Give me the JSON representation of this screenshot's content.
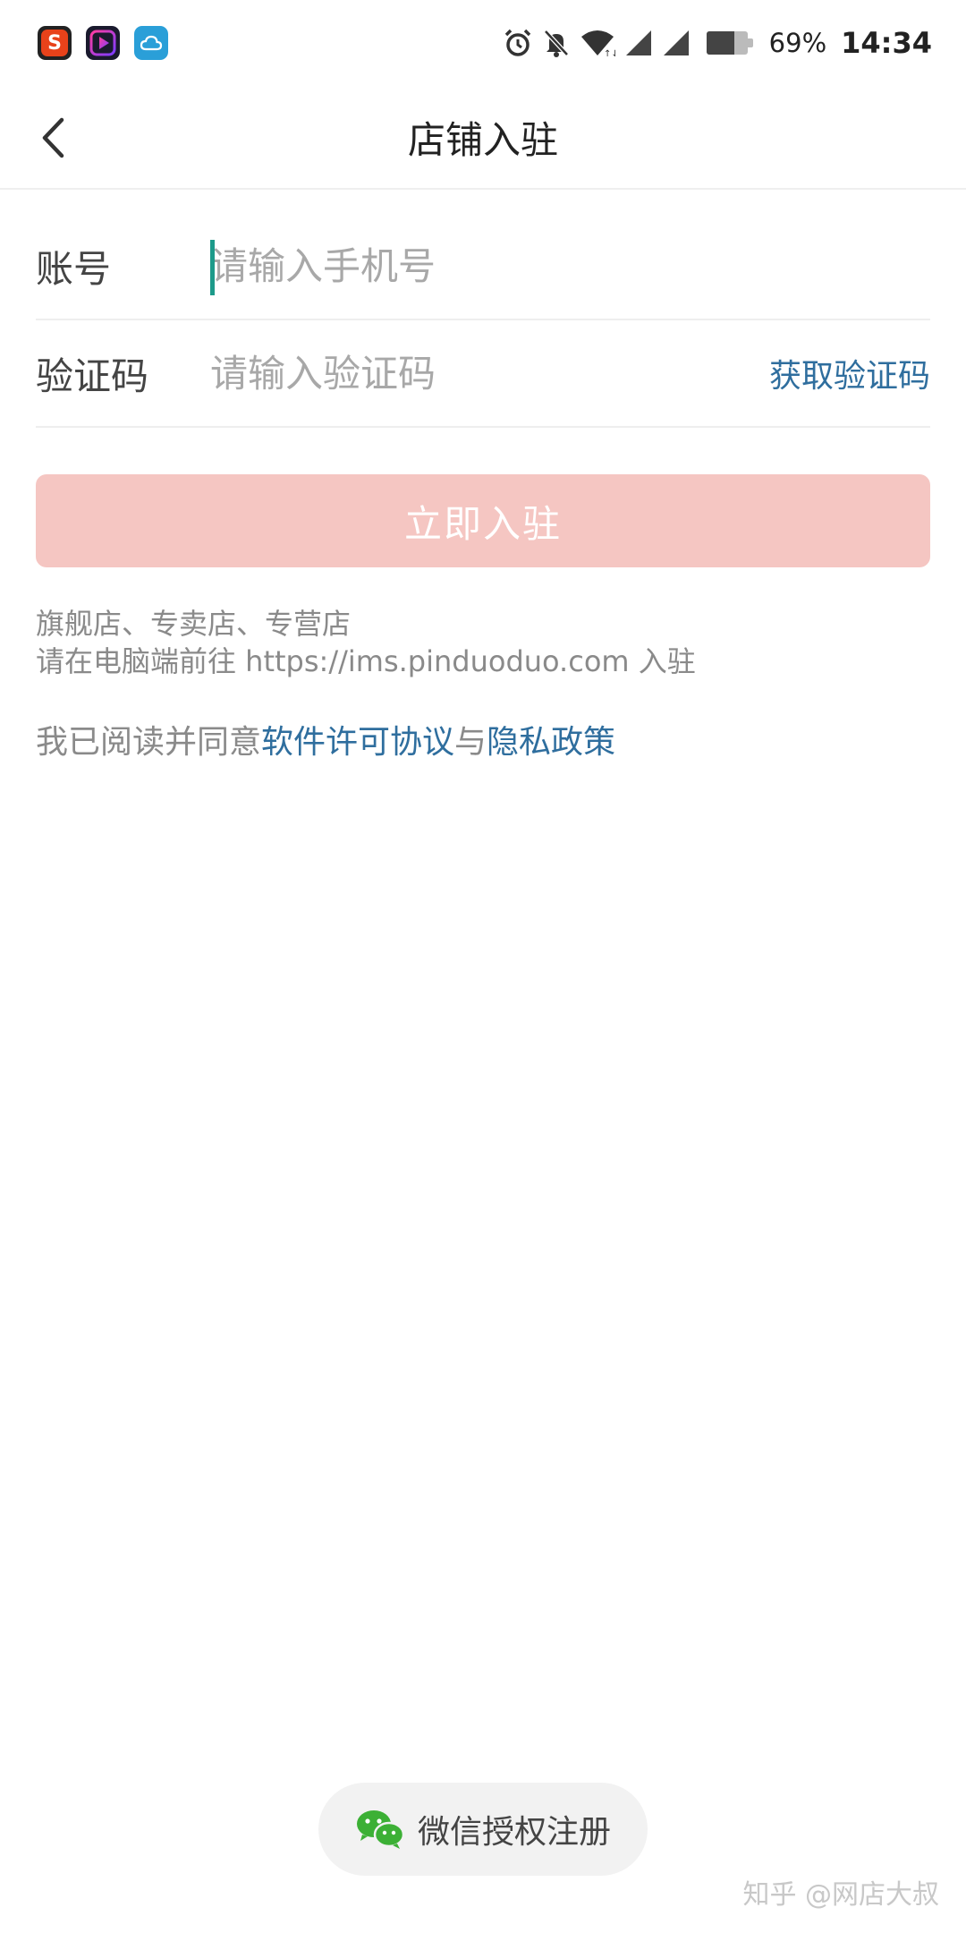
{
  "status_bar": {
    "app_icons": [
      "sogou-icon",
      "video-app-icon",
      "cloud-app-icon"
    ],
    "sogou_letter": "S",
    "battery_percent_text": "69%",
    "battery_level": 0.69,
    "time": "14:34"
  },
  "navbar": {
    "title": "店铺入驻"
  },
  "form": {
    "account": {
      "label": "账号",
      "placeholder": "请输入手机号",
      "value": ""
    },
    "code": {
      "label": "验证码",
      "placeholder": "请输入验证码",
      "value": "",
      "get_code_label": "获取验证码"
    },
    "submit_label": "立即入驻"
  },
  "notes": {
    "line1": "旗舰店、专卖店、专营店",
    "line2": "请在电脑端前往 https://ims.pinduoduo.com 入驻"
  },
  "agreement": {
    "prefix": "我已阅读并同意",
    "license_link": "软件许可协议",
    "connector": "与",
    "privacy_link": "隐私政策"
  },
  "wechat": {
    "label": "微信授权注册"
  },
  "watermark": "知乎 @网店大叔",
  "colors": {
    "accent_link": "#2f6e9e",
    "submit_disabled": "#f5c6c2",
    "cursor": "#1d9a8a",
    "wechat_green": "#3cb035"
  }
}
